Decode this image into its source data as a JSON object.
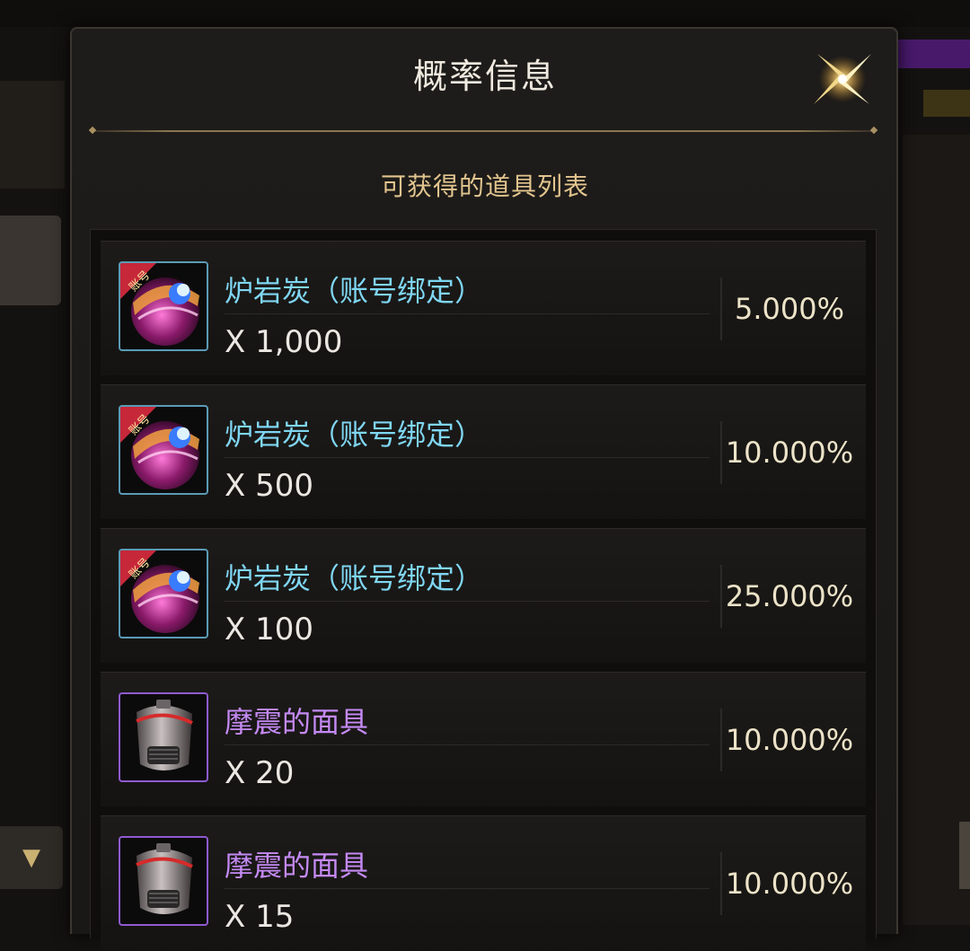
{
  "dialog": {
    "title": "概率信息",
    "subtitle": "可获得的道具列表"
  },
  "items": [
    {
      "name": "炉岩炭（账号绑定）",
      "quantity": "X 1,000",
      "probability": "5.000%",
      "icon": "lava-charcoal-icon",
      "badge": "账号",
      "rarity_color": "#7fd6f2"
    },
    {
      "name": "炉岩炭（账号绑定）",
      "quantity": "X 500",
      "probability": "10.000%",
      "icon": "lava-charcoal-icon",
      "badge": "账号",
      "rarity_color": "#7fd6f2"
    },
    {
      "name": "炉岩炭（账号绑定）",
      "quantity": "X 100",
      "probability": "25.000%",
      "icon": "lava-charcoal-icon",
      "badge": "账号",
      "rarity_color": "#7fd6f2"
    },
    {
      "name": "摩震的面具",
      "quantity": "X 20",
      "probability": "10.000%",
      "icon": "mask-icon",
      "rarity_color": "#c58af5"
    },
    {
      "name": "摩震的面具",
      "quantity": "X 15",
      "probability": "10.000%",
      "icon": "mask-icon",
      "rarity_color": "#c58af5"
    }
  ]
}
